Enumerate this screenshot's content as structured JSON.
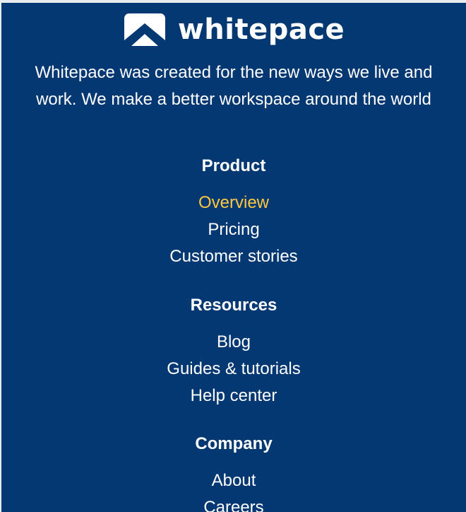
{
  "brand": {
    "name": "whitepace",
    "logo_icon": "house-chevron-logo-icon"
  },
  "tagline": "Whitepace was created for the new ways we live and work. We make a better workspace around the world",
  "colors": {
    "background": "#043873",
    "text": "#ffffff",
    "active_link": "#ffc93f"
  },
  "sections": [
    {
      "heading": "Product",
      "links": [
        {
          "label": "Overview",
          "active": true
        },
        {
          "label": "Pricing",
          "active": false
        },
        {
          "label": "Customer stories",
          "active": false
        }
      ]
    },
    {
      "heading": "Resources",
      "links": [
        {
          "label": "Blog",
          "active": false
        },
        {
          "label": "Guides & tutorials",
          "active": false
        },
        {
          "label": "Help center",
          "active": false
        }
      ]
    },
    {
      "heading": "Company",
      "links": [
        {
          "label": "About",
          "active": false
        },
        {
          "label": "Careers",
          "active": false
        }
      ]
    }
  ]
}
